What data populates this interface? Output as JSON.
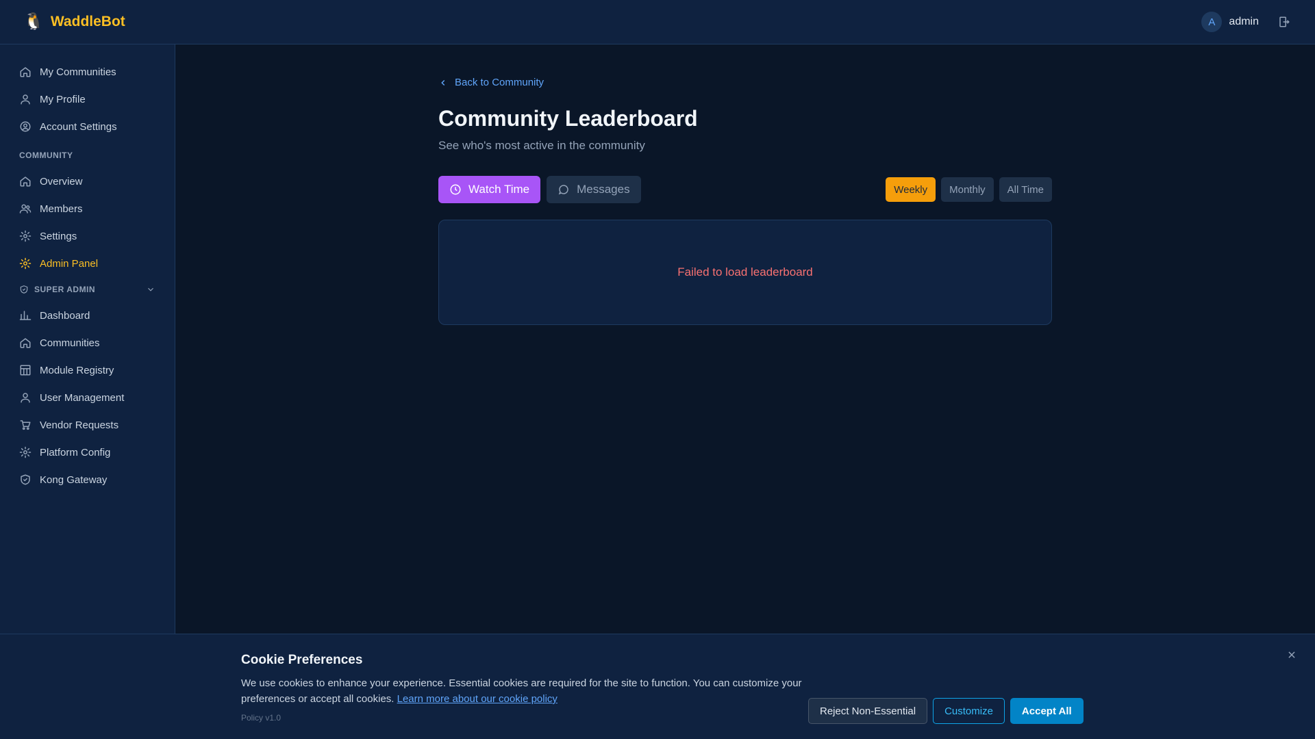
{
  "header": {
    "brand_logo": "🐧",
    "brand_name": "WaddleBot",
    "user_initial": "A",
    "username": "admin"
  },
  "sidebar": {
    "top_items": [
      {
        "label": "My Communities",
        "icon": "home-icon"
      },
      {
        "label": "My Profile",
        "icon": "user-icon"
      },
      {
        "label": "Account Settings",
        "icon": "user-circle-icon"
      }
    ],
    "community_label": "COMMUNITY",
    "community_items": [
      {
        "label": "Overview",
        "icon": "home-icon"
      },
      {
        "label": "Members",
        "icon": "users-icon"
      },
      {
        "label": "Settings",
        "icon": "gear-icon"
      },
      {
        "label": "Admin Panel",
        "icon": "gear-icon"
      }
    ],
    "super_admin_label": "SUPER ADMIN",
    "super_admin_items": [
      {
        "label": "Dashboard",
        "icon": "chart-icon"
      },
      {
        "label": "Communities",
        "icon": "home-icon"
      },
      {
        "label": "Module Registry",
        "icon": "registry-icon"
      },
      {
        "label": "User Management",
        "icon": "user-icon"
      },
      {
        "label": "Vendor Requests",
        "icon": "cart-icon"
      },
      {
        "label": "Platform Config",
        "icon": "gear-icon"
      },
      {
        "label": "Kong Gateway",
        "icon": "shield-icon"
      }
    ]
  },
  "main": {
    "back_label": "Back to Community",
    "title": "Community Leaderboard",
    "subtitle": "See who's most active in the community",
    "tabs": [
      {
        "label": "Watch Time",
        "icon": "clock-icon",
        "active": true
      },
      {
        "label": "Messages",
        "icon": "message-icon",
        "active": false
      }
    ],
    "periods": [
      {
        "label": "Weekly",
        "active": true
      },
      {
        "label": "Monthly",
        "active": false
      },
      {
        "label": "All Time",
        "active": false
      }
    ],
    "error_message": "Failed to load leaderboard"
  },
  "cookie": {
    "title": "Cookie Preferences",
    "text": "We use cookies to enhance your experience. Essential cookies are required for the site to function. You can customize your preferences or accept all cookies.",
    "link_label": "Learn more about our cookie policy",
    "policy_version": "Policy v1.0",
    "reject_label": "Reject Non-Essential",
    "customize_label": "Customize",
    "accept_label": "Accept All"
  },
  "colors": {
    "brand": "#fbbf24",
    "tab_active": "#a855f7",
    "period_active": "#f59e0b",
    "error": "#f87171",
    "link": "#60a5fa"
  }
}
